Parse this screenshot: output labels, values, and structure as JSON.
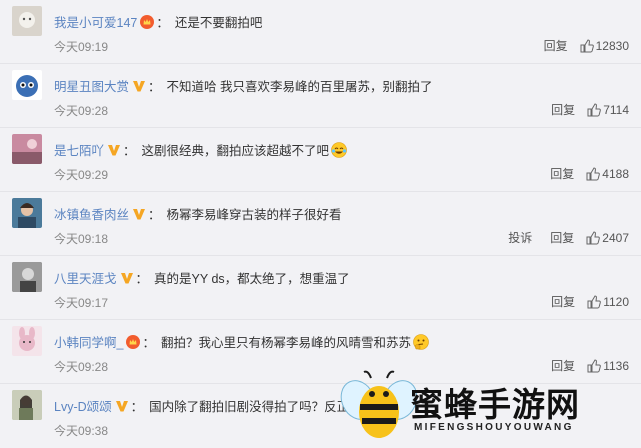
{
  "comments": [
    {
      "name": "我是小可爱147",
      "badge": "crown",
      "text": "还是不要翻拍吧",
      "emoji": "",
      "time": "今天09:19",
      "extra": "",
      "reply": "回复",
      "likes": "12830",
      "avatar_color": "#d9d4cc"
    },
    {
      "name": "明星丑图大赏",
      "badge": "v",
      "text": "不知道哈 我只喜欢李易峰的百里屠苏，别翻拍了",
      "emoji": "",
      "time": "今天09:28",
      "extra": "",
      "reply": "回复",
      "likes": "7114",
      "avatar_color": "#3b6fb5"
    },
    {
      "name": "是七陌吖",
      "badge": "v",
      "text": "这剧很经典，翻拍应该超越不了吧",
      "emoji": "laughing",
      "time": "今天09:29",
      "extra": "",
      "reply": "回复",
      "likes": "4188",
      "avatar_color": "#c98aa0"
    },
    {
      "name": "冰镇鱼香肉丝",
      "badge": "v",
      "text": "杨幂李易峰穿古装的样子很好看",
      "emoji": "",
      "time": "今天09:18",
      "extra": "投诉",
      "reply": "回复",
      "likes": "2407",
      "avatar_color": "#4b7a9a"
    },
    {
      "name": "八里天涯戈",
      "badge": "v",
      "text": "真的是YY ds，都太绝了，想重温了",
      "emoji": "",
      "time": "今天09:17",
      "extra": "",
      "reply": "回复",
      "likes": "1120",
      "avatar_color": "#7a7a7a"
    },
    {
      "name": "小韩同学啊_",
      "badge": "crown",
      "text": "翻拍？我心里只有杨幂李易峰的风晴雪和苏苏",
      "emoji": "thinking",
      "time": "今天09:28",
      "extra": "",
      "reply": "回复",
      "likes": "1136",
      "avatar_color": "#e8b8c8"
    },
    {
      "name": "Lvy-D颂颂",
      "badge": "v",
      "text": "国内除了翻拍旧剧没得拍了吗？反正李易峰",
      "emoji": "",
      "time": "今天09:38",
      "extra": "",
      "reply": "",
      "likes": "",
      "avatar_color": "#b7c0a8"
    }
  ],
  "watermark": {
    "title": "蜜蜂手游网",
    "subtitle": "MIFENGSHOUYOUWANG"
  },
  "colors": {
    "username": "#5b84c1",
    "badge_v": "#f5a623",
    "crown": "#f25c2e",
    "background": "#f2f2f5"
  }
}
